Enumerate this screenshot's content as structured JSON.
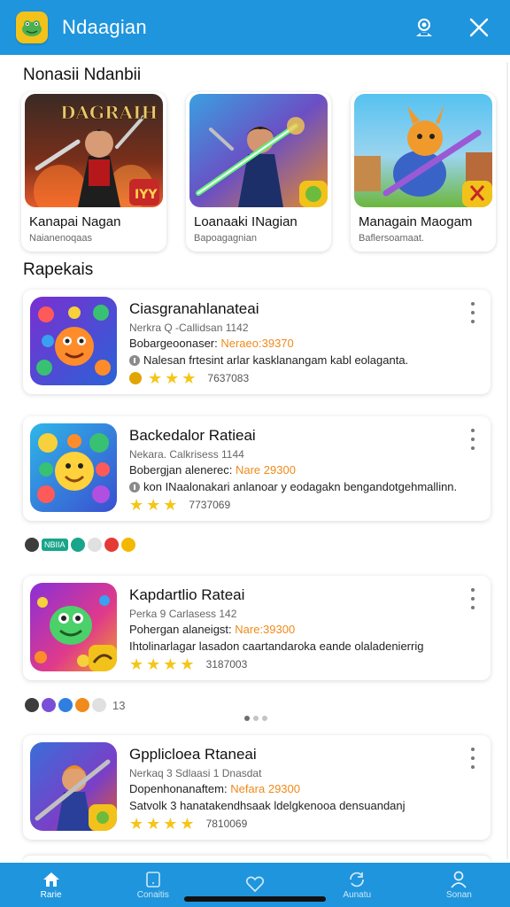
{
  "app": {
    "title": "Ndaagian"
  },
  "sections": {
    "featured_title": "Nonasii Ndanbii",
    "list_title": "Rapekais"
  },
  "featured": [
    {
      "title": "Kanapai Nagan",
      "subtitle": "Naianenoqaas",
      "art_text": "DAGRAIH",
      "badge_text": "IYY"
    },
    {
      "title": "Loanaaki INagian",
      "subtitle": "Bapoagagnian"
    },
    {
      "title": "Managain Maogam",
      "subtitle": "Baflersoamaat."
    }
  ],
  "list": [
    {
      "name": "Ciasgranahlanateai",
      "sub": "Nerkra Q -Callidsan 1142",
      "price_label": "Bobargeoonaser: ",
      "price_value": "Neraeo:39370",
      "desc": "Nalesan frtesint arlar kasklanangam kabl eolaganta.",
      "rating": "7637083",
      "stars": 3
    },
    {
      "name": "Backedalor Ratieai",
      "sub": "Nekara. Calkrisess 1144",
      "price_label": "Bobergjan alenerec: ",
      "price_value": "Nare 29300",
      "desc": "kon INaalonakari anlanoar y eodagakn bengandotgehmallinn.",
      "rating": "7737069",
      "stars": 3
    },
    {
      "name": "Kapdartlio Rateai",
      "sub": "Perka 9 Carlasess 142",
      "price_label": "Pohergan alaneigst: ",
      "price_value": "Nare:39300",
      "desc": "Ihtolinarlagar lasadon caartandaroka eande olaladenierrig",
      "rating": "3187003",
      "stars": 4
    },
    {
      "name": "Gpplicloea Rtaneai",
      "sub": "Nerkaq 3 Sdlaasi 1 Dnasdat",
      "price_label": "Dopenhonanaftem: ",
      "price_value": "Nefara 29300",
      "desc": "Satvolk 3 hanatakendhsaak ldelgkenooa densuandanj",
      "rating": "7810069",
      "stars": 4
    }
  ],
  "chip_rows": [
    {
      "tag": "NBIIA",
      "count": ""
    },
    {
      "tag": "",
      "count": "13"
    }
  ],
  "nav": [
    {
      "label": "Rarie",
      "icon": "home-icon",
      "active": true
    },
    {
      "label": "Conaitis",
      "icon": "tablet-icon",
      "active": false
    },
    {
      "label": "",
      "icon": "heart-icon",
      "active": false
    },
    {
      "label": "Aunatu",
      "icon": "sync-icon",
      "active": false
    },
    {
      "label": "Sonan",
      "icon": "person-icon",
      "active": false
    }
  ],
  "icons": {
    "top": [
      "contact-support-icon",
      "close-icon"
    ]
  },
  "colors": {
    "header": "#1f95dd",
    "price_accent": "#f08a1a",
    "star": "#f5c518"
  }
}
